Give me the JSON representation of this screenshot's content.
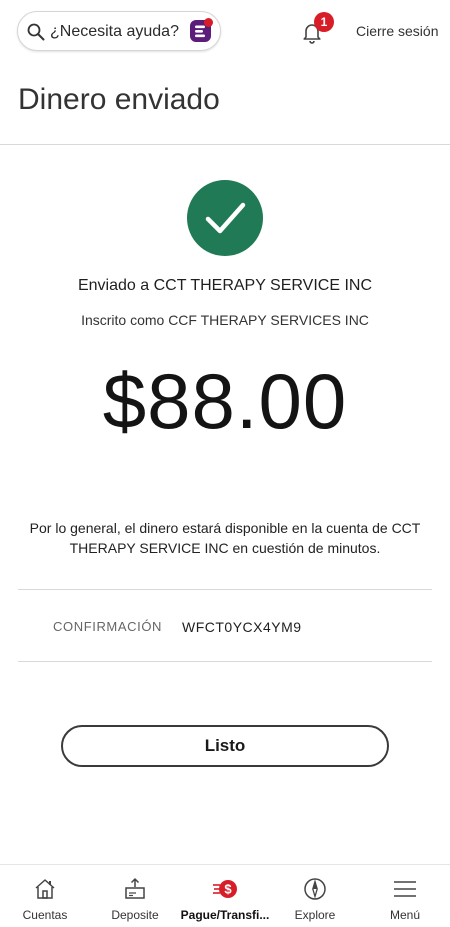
{
  "header": {
    "search_placeholder": "¿Necesita ayuda?",
    "notifications_count": "1",
    "logout_label": "Cierre sesión"
  },
  "page": {
    "title": "Dinero enviado"
  },
  "transfer": {
    "sent_to": "Enviado a CCT THERAPY SERVICE INC",
    "enrolled_as": "Inscrito como CCF THERAPY SERVICES INC",
    "amount": "$88.00",
    "notice": "Por lo general, el dinero estará disponible en la cuenta de CCT THERAPY SERVICE INC en cuestión de minutos.",
    "confirmation_label": "CONFIRMACIÓN",
    "confirmation_number": "WFCT0YCX4YM9"
  },
  "actions": {
    "done_label": "Listo"
  },
  "bottom_nav": {
    "items": [
      {
        "label": "Cuentas",
        "icon": "house-icon"
      },
      {
        "label": "Deposite",
        "icon": "deposit-icon"
      },
      {
        "label": "Pague/Transfi...",
        "icon": "pay-transfer-icon"
      },
      {
        "label": "Explore",
        "icon": "compass-icon"
      },
      {
        "label": "Menú",
        "icon": "hamburger-menu-icon"
      }
    ],
    "active_index": 2
  },
  "colors": {
    "success_green": "#1f7a55",
    "brand_red": "#d71e28",
    "assistant_purple": "#5a1e7a"
  }
}
